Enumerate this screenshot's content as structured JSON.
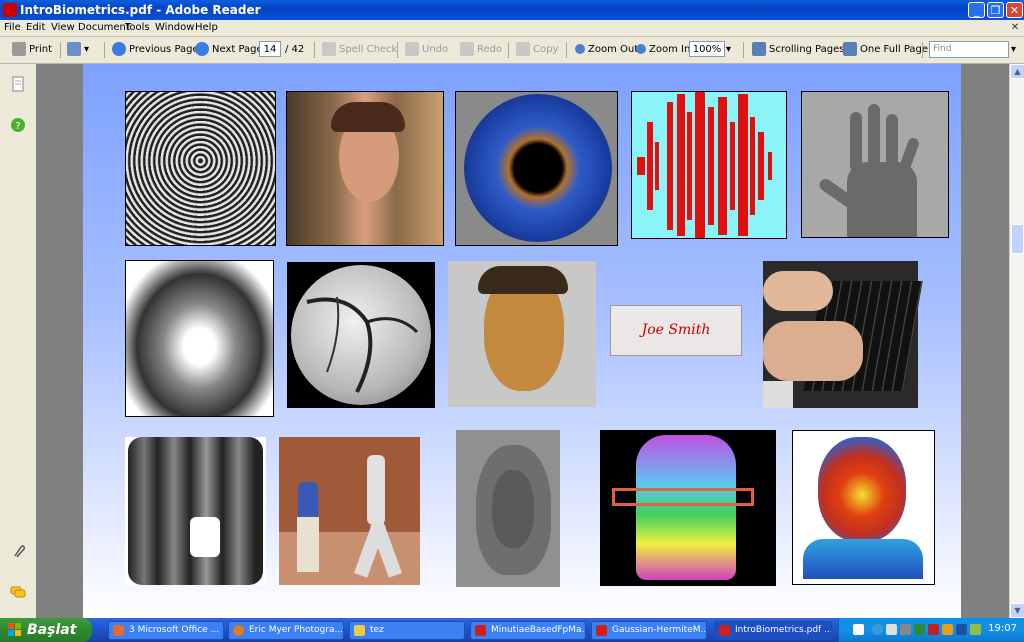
{
  "window": {
    "title": "IntroBiometrics.pdf - Adobe Reader",
    "buttons": [
      "_",
      "❐",
      "✕"
    ]
  },
  "menu": [
    "File",
    "Edit",
    "View",
    "Document",
    "Tools",
    "Window",
    "Help"
  ],
  "toolbar": {
    "print": "Print",
    "previous_page": "Previous Page",
    "next_page": "Next Page",
    "current_page": "14",
    "total_pages": "/ 42",
    "spell_check": "Spell Check",
    "undo": "Undo",
    "redo": "Redo",
    "copy": "Copy",
    "zoom_out": "Zoom Out",
    "zoom_in": "Zoom In",
    "zoom_level": "100%",
    "scrolling_pages": "Scrolling Pages",
    "one_full_page": "One Full Page",
    "find_placeholder": "Find"
  },
  "page": {
    "images": [
      "fingerprint",
      "face",
      "iris",
      "voice-waveform",
      "hand-geometry",
      "palmprint",
      "retina",
      "3d-face",
      "signature",
      "keystroke",
      "dental-xray",
      "gait",
      "ear",
      "hand-thermogram",
      "face-thermogram"
    ],
    "signature_text": "Joe Smith"
  },
  "taskbar": {
    "start_label": "Başlat",
    "tasks": [
      "3 Microsoft Office ...",
      "Eric Myer Photogra...",
      "tez",
      "MinutiaeBasedFpMa...",
      "Gaussian-HermiteM...",
      "IntroBiometrics.pdf ..."
    ],
    "clock": "19:07"
  }
}
